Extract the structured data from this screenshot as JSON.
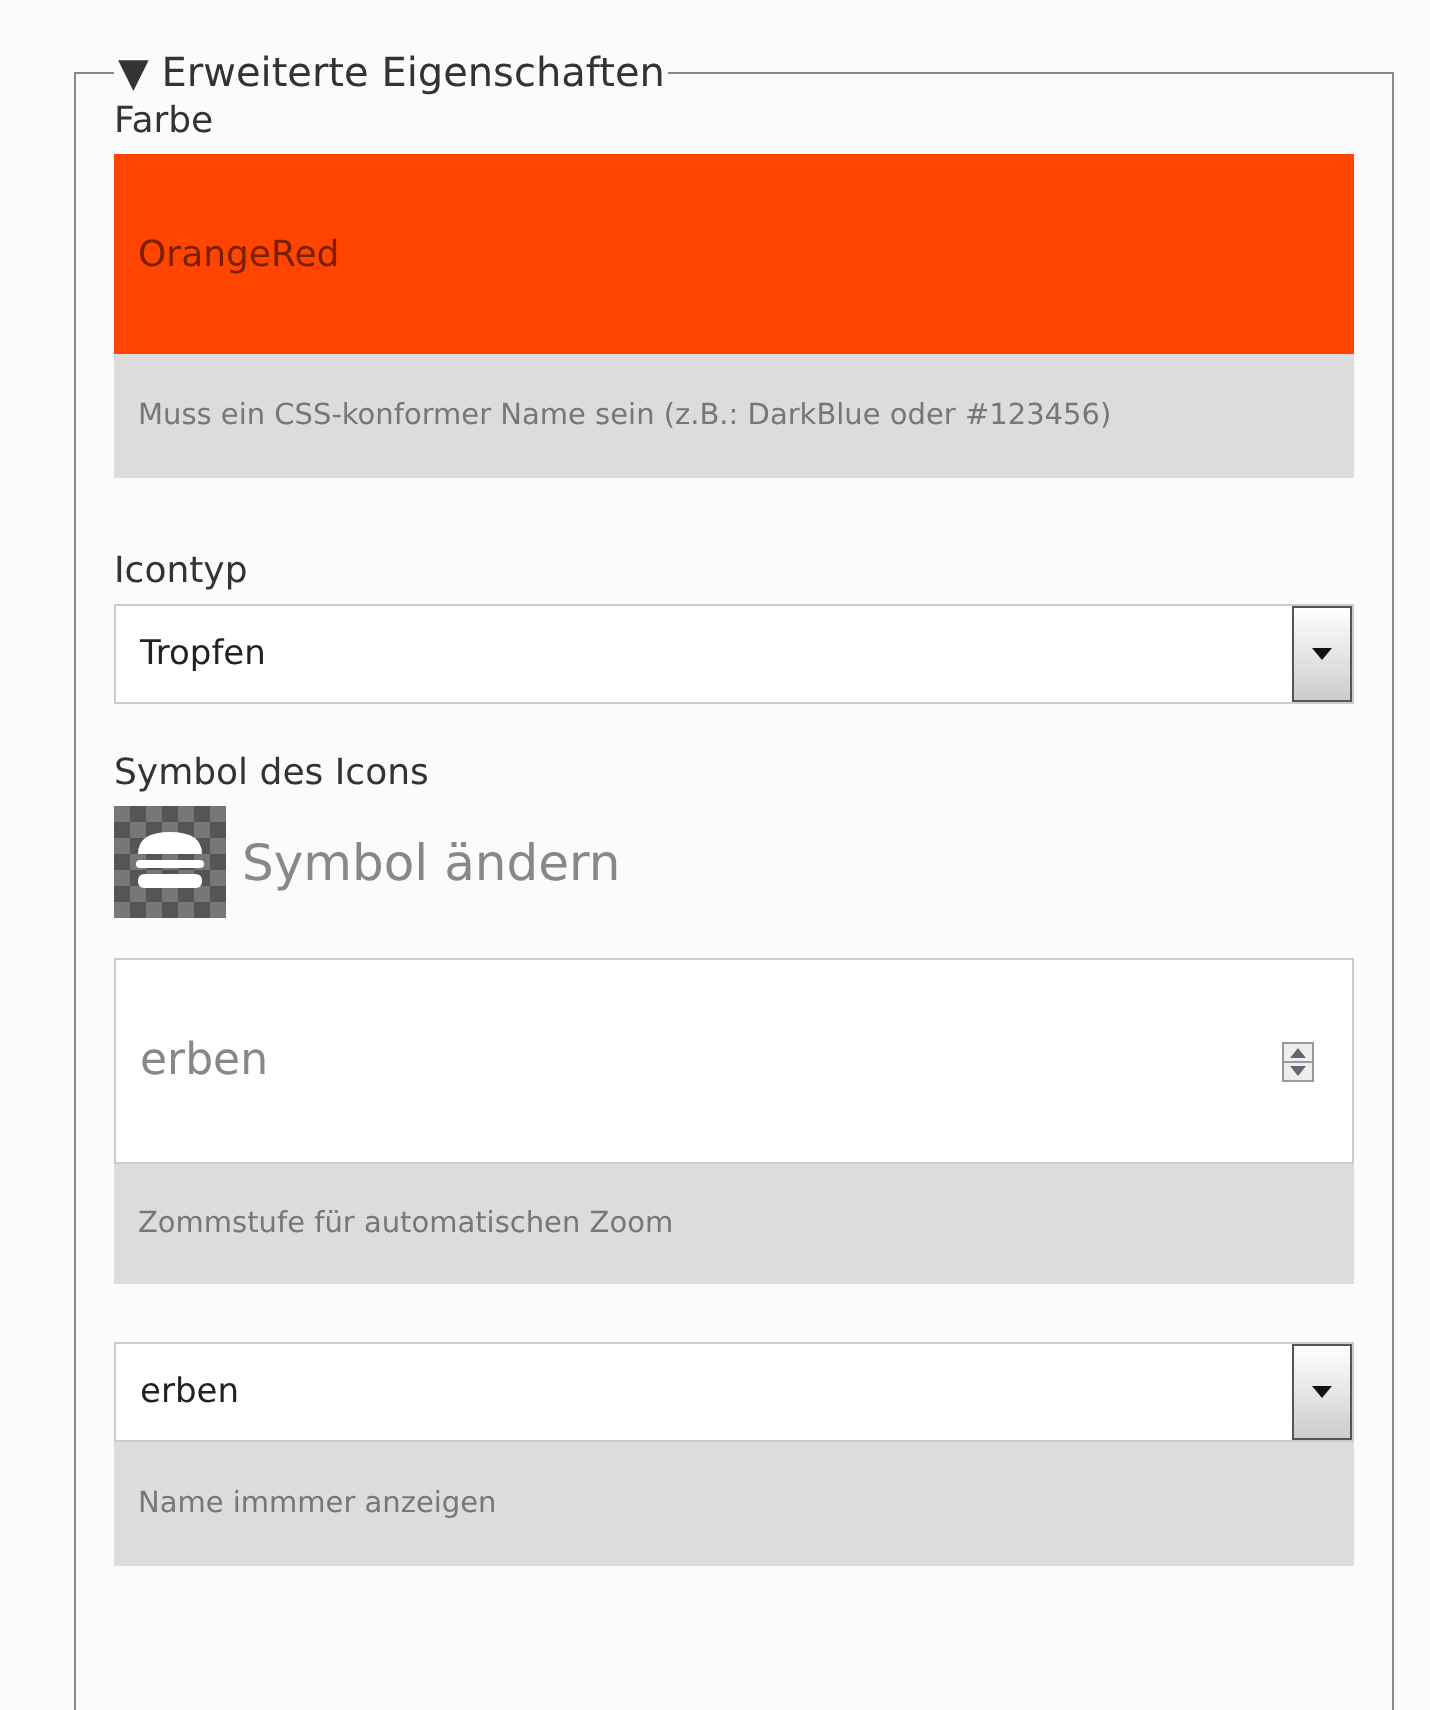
{
  "section": {
    "title": "Erweiterte Eigenschaften",
    "expanded": true,
    "toggle": "▼"
  },
  "color_field": {
    "label": "Farbe",
    "value": "OrangeRed",
    "color": "#ff4500",
    "hint": "Muss ein CSS-konformer Name sein (z.B.: DarkBlue oder #123456)"
  },
  "icon_type": {
    "label": "Icontyp",
    "value": "Tropfen"
  },
  "icon_symbol": {
    "label": "Symbol des Icons",
    "button": "Symbol ändern"
  },
  "zoom_field": {
    "placeholder": "erben",
    "hint": "Zommstufe für automatischen Zoom"
  },
  "name_select": {
    "value": "erben",
    "hint": "Name immmer anzeigen"
  }
}
